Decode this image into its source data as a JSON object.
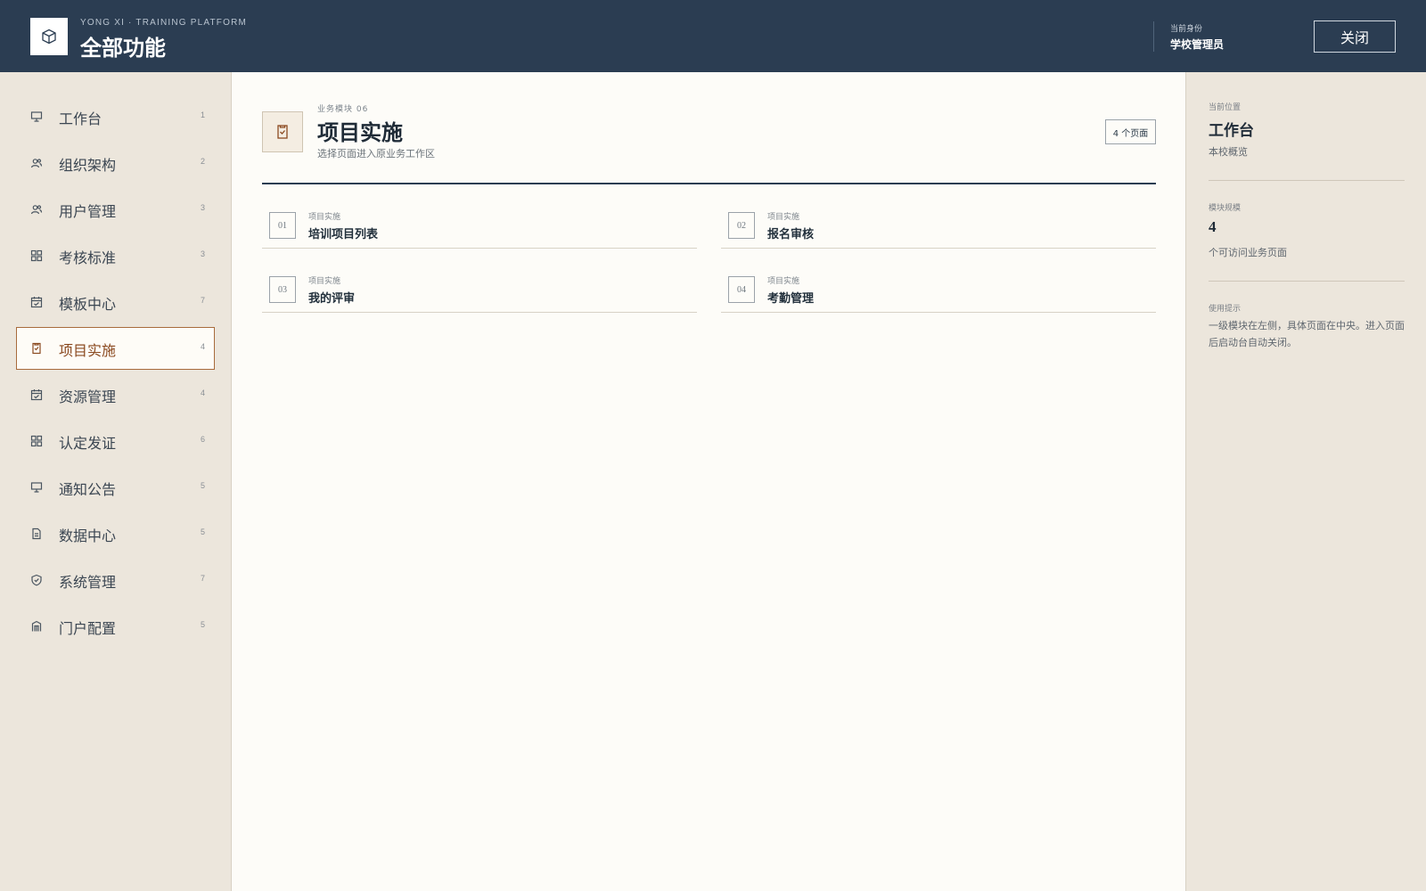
{
  "header": {
    "brand_sub": "YONG XI · TRAINING PLATFORM",
    "title": "全部功能",
    "role_label": "当前身份",
    "role_value": "学校管理员",
    "close_label": "关闭",
    "logo_icon": "cube-icon"
  },
  "sidebar": {
    "items": [
      {
        "label": "工作台",
        "count": "1",
        "icon": "monitor-icon"
      },
      {
        "label": "组织架构",
        "count": "2",
        "icon": "users-icon"
      },
      {
        "label": "用户管理",
        "count": "3",
        "icon": "users-icon"
      },
      {
        "label": "考核标准",
        "count": "3",
        "icon": "grid-icon"
      },
      {
        "label": "模板中心",
        "count": "7",
        "icon": "calendar-check-icon"
      },
      {
        "label": "项目实施",
        "count": "4",
        "icon": "clipboard-check-icon",
        "active": true
      },
      {
        "label": "资源管理",
        "count": "4",
        "icon": "calendar-check-icon"
      },
      {
        "label": "认定发证",
        "count": "6",
        "icon": "grid-icon"
      },
      {
        "label": "通知公告",
        "count": "5",
        "icon": "monitor-icon"
      },
      {
        "label": "数据中心",
        "count": "5",
        "icon": "document-icon"
      },
      {
        "label": "系统管理",
        "count": "7",
        "icon": "shield-check-icon"
      },
      {
        "label": "门户配置",
        "count": "5",
        "icon": "building-icon"
      }
    ]
  },
  "module": {
    "sub": "业务模块 06",
    "title": "项目实施",
    "desc": "选择页面进入原业务工作区",
    "badge": "4 个页面",
    "icon": "clipboard-check-icon",
    "pages": [
      {
        "num": "01",
        "category": "项目实施",
        "title": "培训项目列表"
      },
      {
        "num": "02",
        "category": "项目实施",
        "title": "报名审核"
      },
      {
        "num": "03",
        "category": "项目实施",
        "title": "我的评审"
      },
      {
        "num": "04",
        "category": "项目实施",
        "title": "考勤管理"
      }
    ]
  },
  "right_panel": {
    "location_label": "当前位置",
    "location_title": "工作台",
    "location_desc": "本校概览",
    "scale_label": "模块规模",
    "scale_value": "4",
    "scale_desc": "个可访问业务页面",
    "tip_label": "使用提示",
    "tip_text": "一级模块在左侧，具体页面在中央。进入页面后启动台自动关闭。"
  },
  "colors": {
    "header_bg": "#2b3d52",
    "sidebar_bg": "#ece6dc",
    "accent": "#a86b3c",
    "main_bg": "#fdfcf8"
  }
}
